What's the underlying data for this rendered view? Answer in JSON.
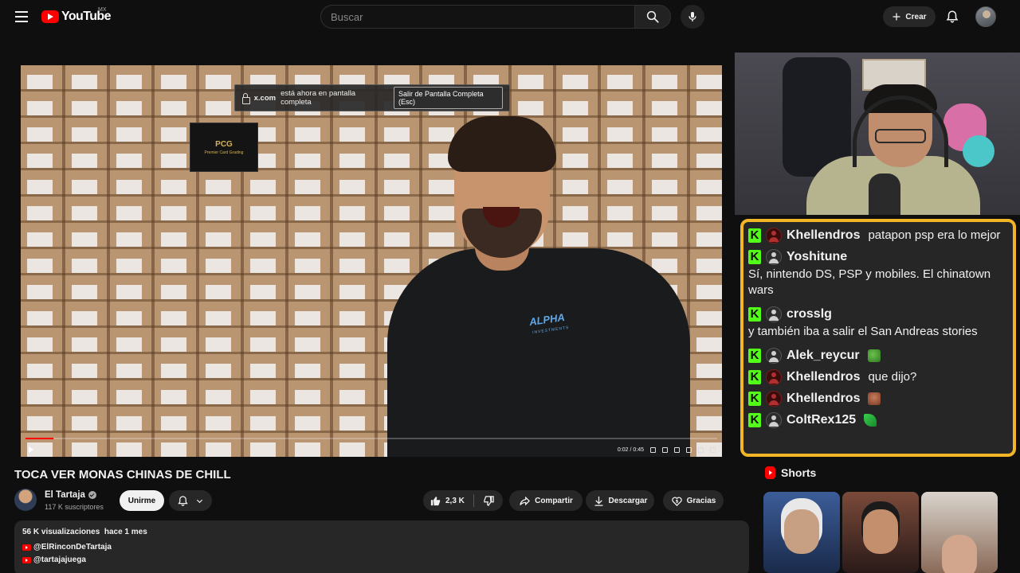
{
  "header": {
    "logo_text": "YouTube",
    "country_code": "MX",
    "search_placeholder": "Buscar",
    "create_label": "Crear"
  },
  "video": {
    "fullscreen_toast": {
      "domain": "x.com",
      "message": "está ahora en pantalla completa",
      "exit_label": "Salir de Pantalla Completa (Esc)"
    },
    "box_brand": "PCG",
    "box_brand_sub": "Premier Card Grading",
    "shirt_text": "ALPHA",
    "shirt_subtext": "INVESTMENTS",
    "time_current": "0:02",
    "time_total": "0:45",
    "progress_fraction": 0.04
  },
  "chat": {
    "messages": [
      {
        "user": "Khellendros",
        "avatar": "red",
        "text": "patapon psp era lo mejor",
        "inline": true
      },
      {
        "user": "Yoshitune",
        "avatar": "default",
        "text": "Sí, nintendo DS, PSP y mobiles. El chinatown wars",
        "inline": false
      },
      {
        "user": "crosslg",
        "avatar": "default",
        "text": "y también iba a salir el San Andreas stories",
        "inline": false
      },
      {
        "user": "Alek_reycur",
        "avatar": "default",
        "text": "",
        "emote": "frog-emote",
        "inline": true
      },
      {
        "user": "Khellendros",
        "avatar": "red",
        "text": "que dijo?",
        "inline": true
      },
      {
        "user": "Khellendros",
        "avatar": "red",
        "text": "",
        "emote": "face-emote",
        "inline": true
      },
      {
        "user": "ColtRex125",
        "avatar": "default",
        "text": "",
        "emote": "leaf-emote",
        "inline": true
      }
    ]
  },
  "info": {
    "title": "TOCA VER MONAS CHINAS DE CHILL",
    "channel": "El Tartaja",
    "subscribers": "117 K suscriptores",
    "join_label": "Unirme",
    "like_count": "2,3 K",
    "share_label": "Compartir",
    "download_label": "Descargar",
    "thanks_label": "Gracias"
  },
  "description": {
    "views": "56 K visualizaciones",
    "age": "hace 1 mes",
    "links": [
      "@ElRinconDeTartaja",
      "@tartajajuega"
    ]
  },
  "shorts": {
    "heading": "Shorts"
  },
  "colors": {
    "brand_red": "#ff0000",
    "chat_border": "#f1b527",
    "kick_green": "#53fc18",
    "background": "#0f0f0f"
  }
}
